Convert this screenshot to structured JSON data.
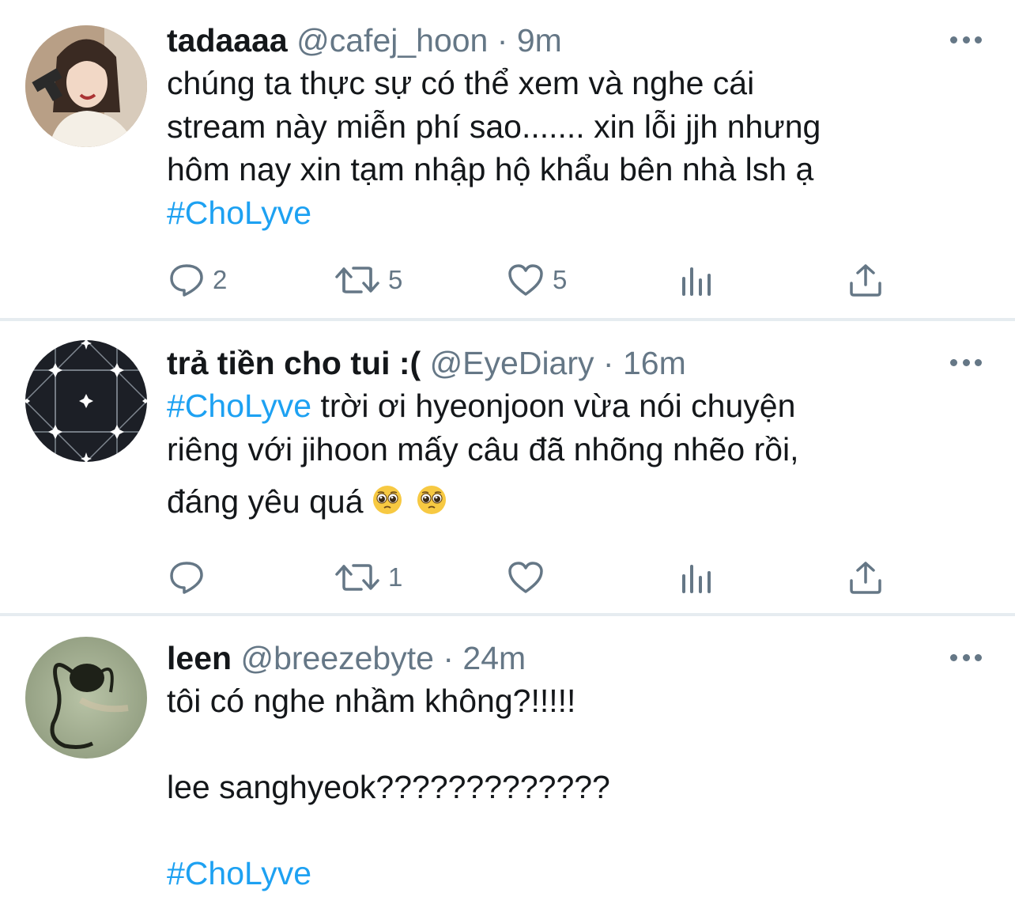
{
  "tweets": [
    {
      "name": "tadaaaa",
      "handle": "@cafej_hoon",
      "separator": "·",
      "time": "9m",
      "lines": [
        "chúng ta thực sự có thể xem và nghe cái",
        "stream này miễn phí sao....... xin lỗi jjh nhưng",
        "hôm nay xin tạm nhập hộ khẩu bên nhà lsh ạ"
      ],
      "hashtag": "#ChoLyve",
      "replies": "2",
      "retweets": "5",
      "likes": "5"
    },
    {
      "name": "trả tiền cho tui :(",
      "handle": "@EyeDiary",
      "separator": "·",
      "time": "16m",
      "hashtag": "#ChoLyve",
      "line1_rest": " trời ơi hyeonjoon vừa nói chuyện",
      "line2": "riêng với jihoon mấy câu đã nhõng nhẽo rồi,",
      "line3": "đáng yêu quá",
      "emoji": "pleading-face-emoji",
      "replies": "",
      "retweets": "1",
      "likes": ""
    },
    {
      "name": "leen",
      "handle": "@breezebyte",
      "separator": "·",
      "time": "24m",
      "line1": "tôi có nghe nhầm không?!!!!!",
      "line2": "lee sanghyeok?????????????",
      "hashtag": "#ChoLyve"
    }
  ],
  "icons": [
    "reply-icon",
    "retweet-icon",
    "like-icon",
    "analytics-icon",
    "share-icon",
    "more-icon"
  ],
  "colors": {
    "text": "#14171a",
    "secondary": "#657786",
    "link": "#1da1f2",
    "divider": "#e6ecf0"
  }
}
